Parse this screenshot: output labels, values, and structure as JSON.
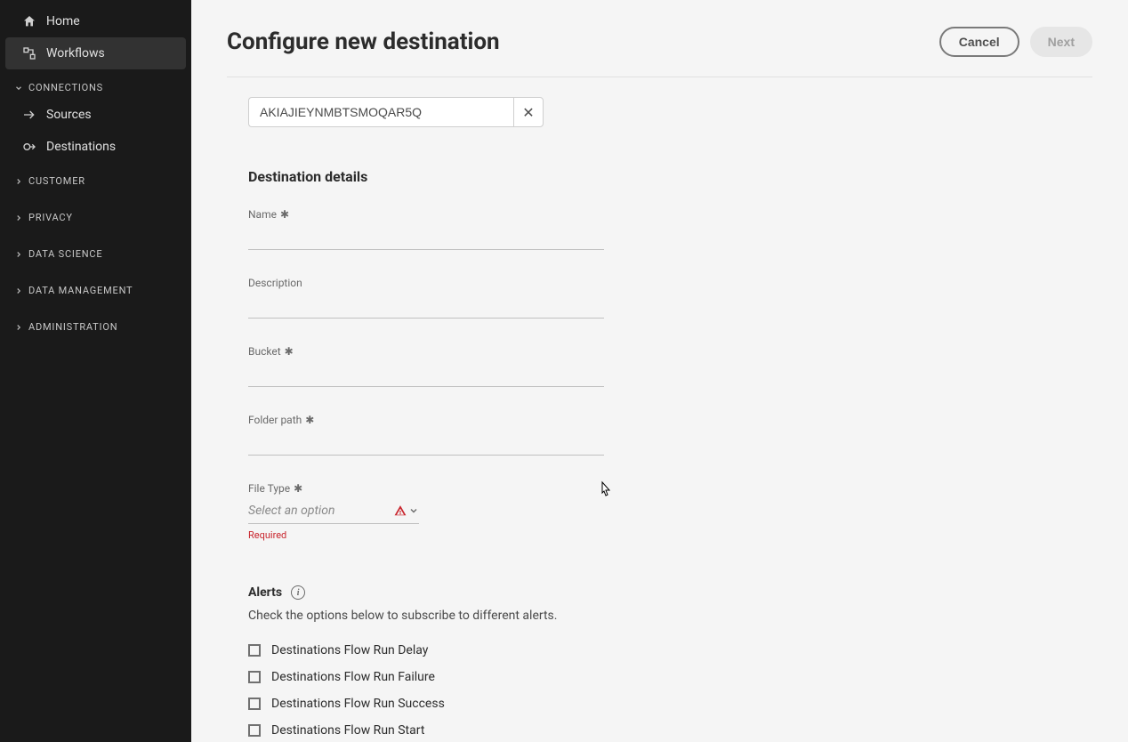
{
  "sidebar": {
    "home": "Home",
    "workflows": "Workflows",
    "sections": {
      "connections": "CONNECTIONS",
      "sources": "Sources",
      "destinations": "Destinations",
      "customer": "CUSTOMER",
      "privacy": "PRIVACY",
      "data_science": "DATA SCIENCE",
      "data_management": "DATA MANAGEMENT",
      "administration": "ADMINISTRATION"
    }
  },
  "header": {
    "title": "Configure new destination",
    "cancel": "Cancel",
    "next": "Next"
  },
  "token": {
    "value": "AKIAJIEYNMBTSMOQAR5Q"
  },
  "details": {
    "section_title": "Destination details",
    "name_label": "Name",
    "description_label": "Description",
    "bucket_label": "Bucket",
    "folder_label": "Folder path",
    "filetype_label": "File Type",
    "filetype_placeholder": "Select an option",
    "filetype_error": "Required"
  },
  "alerts": {
    "title": "Alerts",
    "description": "Check the options below to subscribe to different alerts.",
    "items": [
      "Destinations Flow Run Delay",
      "Destinations Flow Run Failure",
      "Destinations Flow Run Success",
      "Destinations Flow Run Start"
    ]
  }
}
